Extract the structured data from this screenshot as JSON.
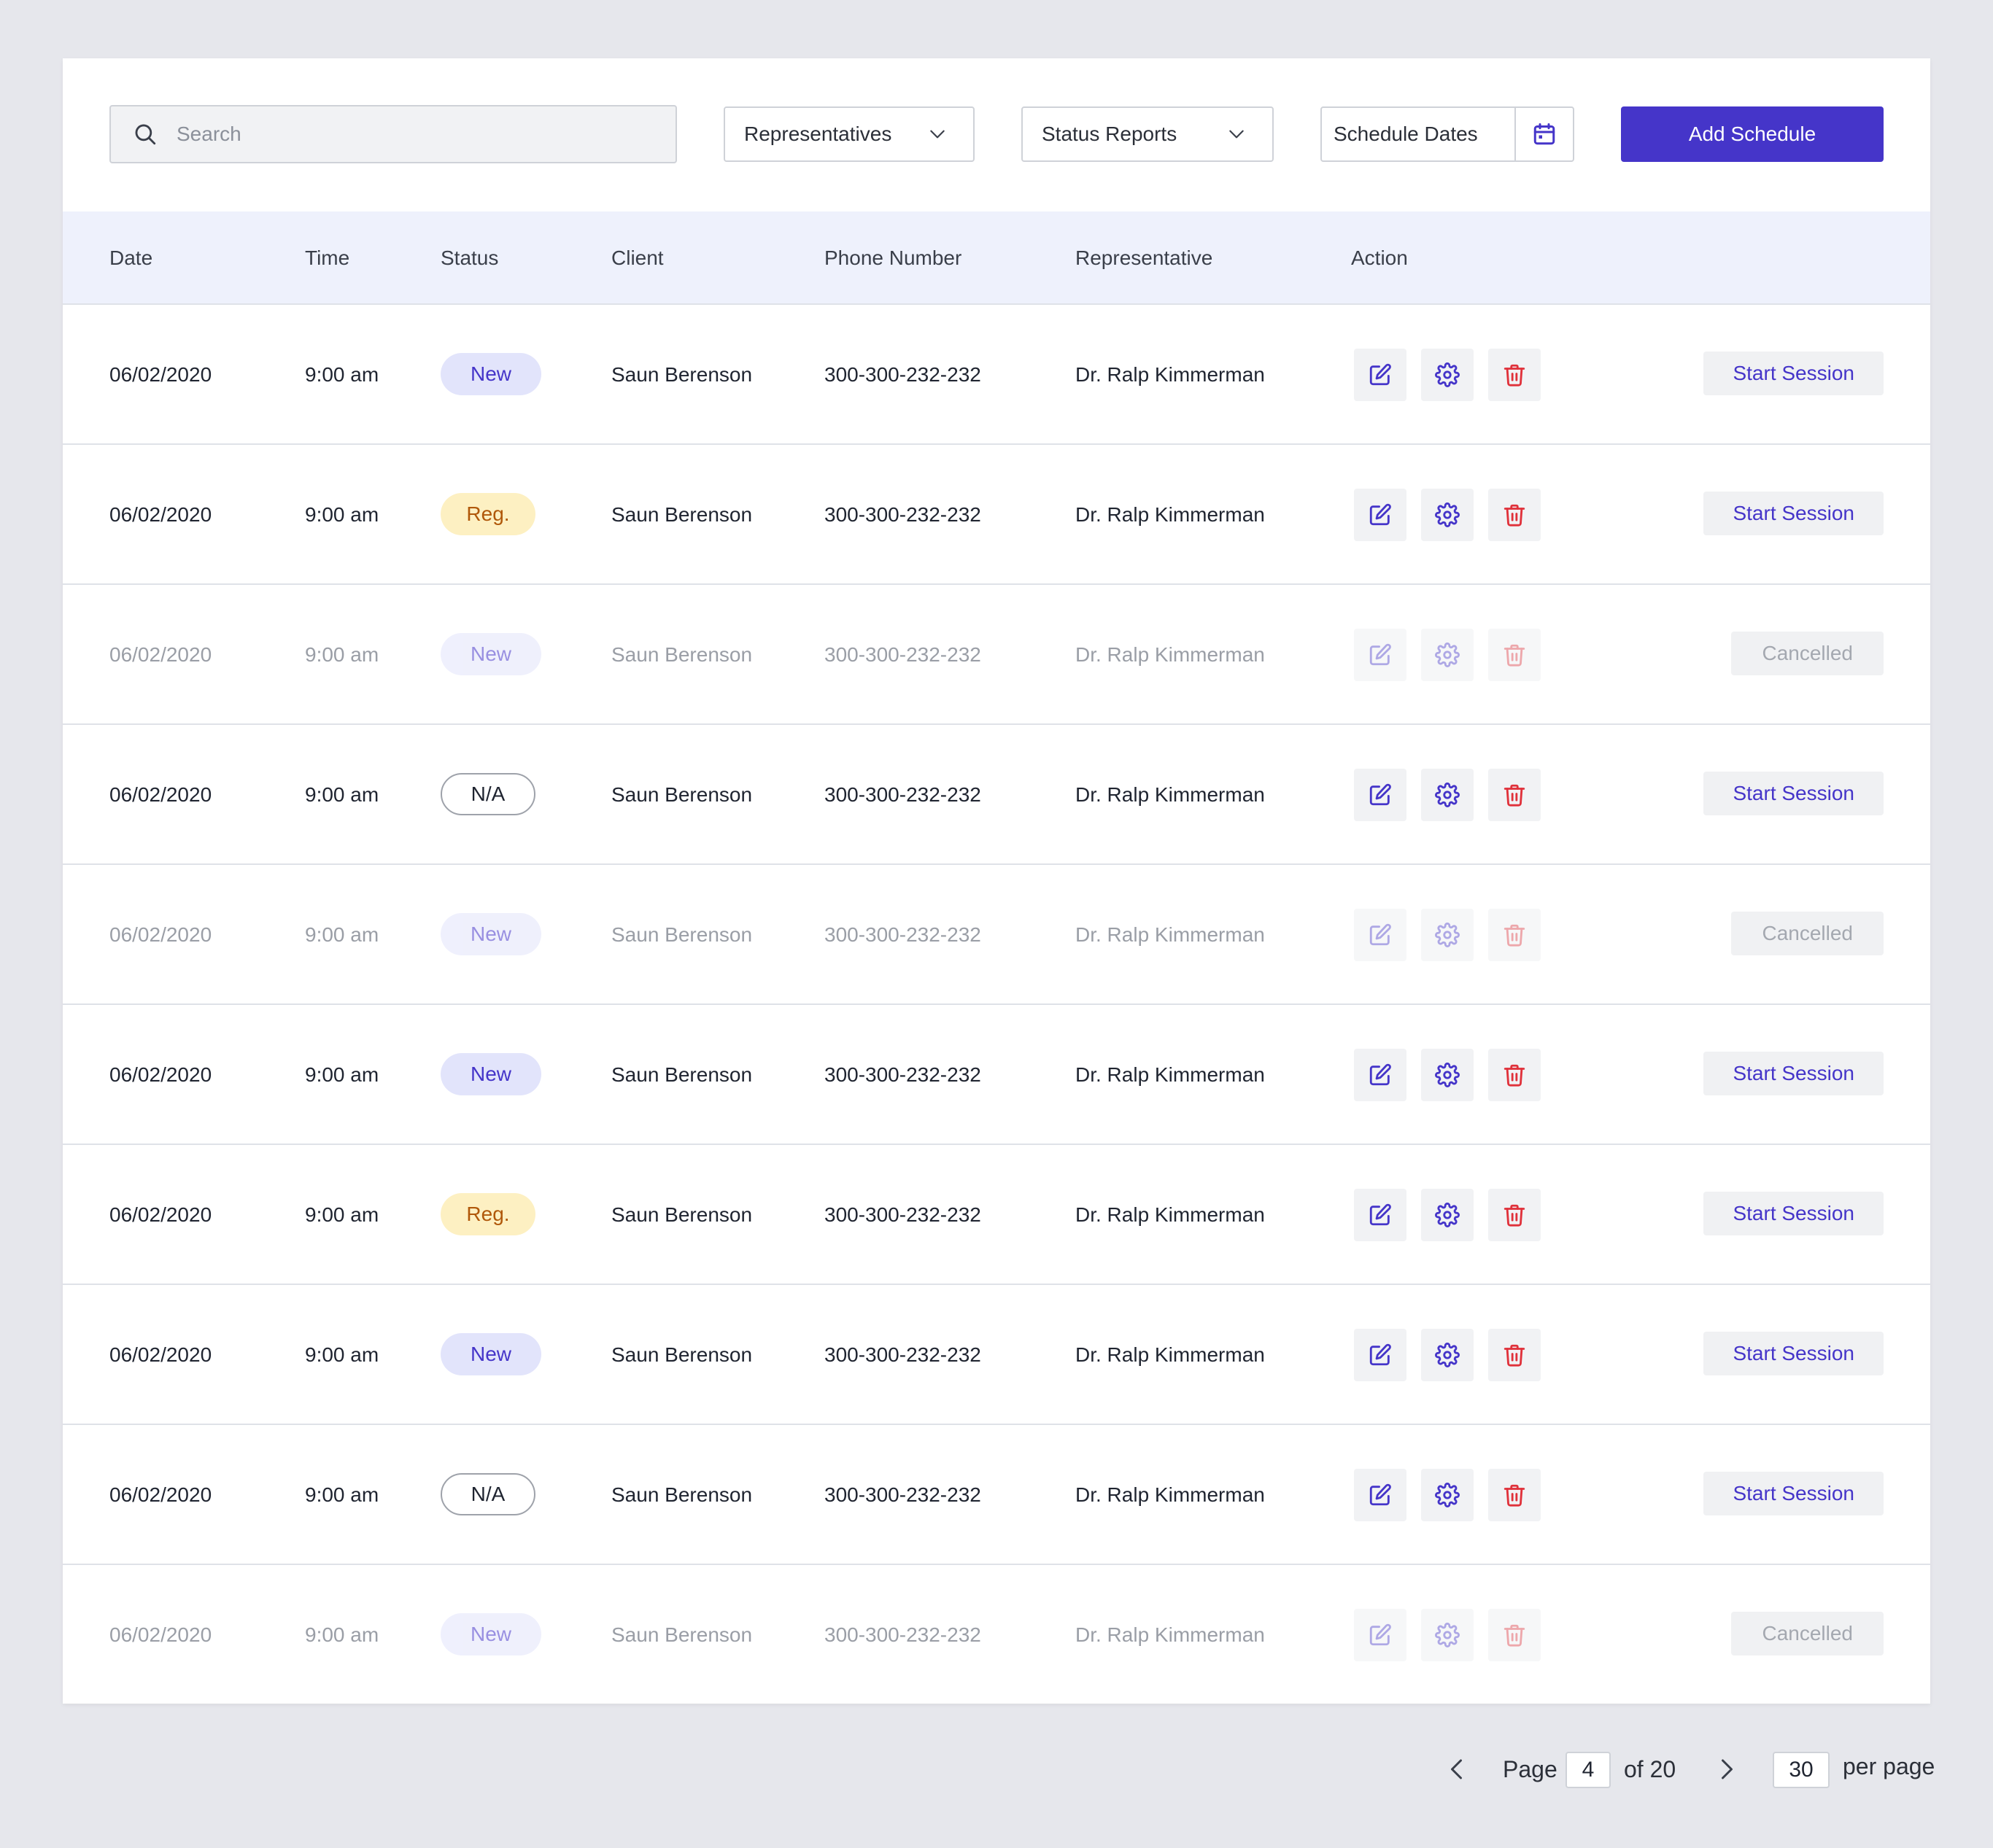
{
  "toolbar": {
    "search_placeholder": "Search",
    "search_value": "",
    "representatives_label": "Representatives",
    "status_reports_label": "Status Reports",
    "schedule_dates_label": "Schedule Dates",
    "add_schedule_label": "Add Schedule",
    "icons": {
      "search": "search-icon",
      "chevron": "chevron-down-icon",
      "calendar": "calendar-icon"
    }
  },
  "table": {
    "headers": {
      "date": "Date",
      "time": "Time",
      "status": "Status",
      "client": "Client",
      "phone": "Phone Number",
      "representative": "Representative",
      "action": "Action"
    },
    "rows": [
      {
        "date": "06/02/2020",
        "time": "9:00 am",
        "status": "New",
        "status_type": "new",
        "client": "Saun Berenson",
        "phone": "300-300-232-232",
        "representative": "Dr. Ralp Kimmerman",
        "session": "Start Session",
        "cancelled": false
      },
      {
        "date": "06/02/2020",
        "time": "9:00 am",
        "status": "Reg.",
        "status_type": "reg",
        "client": "Saun Berenson",
        "phone": "300-300-232-232",
        "representative": "Dr. Ralp Kimmerman",
        "session": "Start Session",
        "cancelled": false
      },
      {
        "date": "06/02/2020",
        "time": "9:00 am",
        "status": "New",
        "status_type": "new",
        "client": "Saun Berenson",
        "phone": "300-300-232-232",
        "representative": "Dr. Ralp Kimmerman",
        "session": "Cancelled",
        "cancelled": true
      },
      {
        "date": "06/02/2020",
        "time": "9:00 am",
        "status": "N/A",
        "status_type": "na",
        "client": "Saun Berenson",
        "phone": "300-300-232-232",
        "representative": "Dr. Ralp Kimmerman",
        "session": "Start Session",
        "cancelled": false
      },
      {
        "date": "06/02/2020",
        "time": "9:00 am",
        "status": "New",
        "status_type": "new",
        "client": "Saun Berenson",
        "phone": "300-300-232-232",
        "representative": "Dr. Ralp Kimmerman",
        "session": "Cancelled",
        "cancelled": true
      },
      {
        "date": "06/02/2020",
        "time": "9:00 am",
        "status": "New",
        "status_type": "new",
        "client": "Saun Berenson",
        "phone": "300-300-232-232",
        "representative": "Dr. Ralp Kimmerman",
        "session": "Start Session",
        "cancelled": false
      },
      {
        "date": "06/02/2020",
        "time": "9:00 am",
        "status": "Reg.",
        "status_type": "reg",
        "client": "Saun Berenson",
        "phone": "300-300-232-232",
        "representative": "Dr. Ralp Kimmerman",
        "session": "Start Session",
        "cancelled": false
      },
      {
        "date": "06/02/2020",
        "time": "9:00 am",
        "status": "New",
        "status_type": "new",
        "client": "Saun Berenson",
        "phone": "300-300-232-232",
        "representative": "Dr. Ralp Kimmerman",
        "session": "Start Session",
        "cancelled": false
      },
      {
        "date": "06/02/2020",
        "time": "9:00 am",
        "status": "N/A",
        "status_type": "na",
        "client": "Saun Berenson",
        "phone": "300-300-232-232",
        "representative": "Dr. Ralp Kimmerman",
        "session": "Start Session",
        "cancelled": false
      },
      {
        "date": "06/02/2020",
        "time": "9:00 am",
        "status": "New",
        "status_type": "new",
        "client": "Saun Berenson",
        "phone": "300-300-232-232",
        "representative": "Dr. Ralp Kimmerman",
        "session": "Cancelled",
        "cancelled": true
      }
    ],
    "action_icons": [
      "edit-icon",
      "gear-icon",
      "trash-icon"
    ]
  },
  "pagination": {
    "page_label": "Page",
    "current_page": "4",
    "of_label": "of 20",
    "per_page_value": "30",
    "per_page_label": "per page",
    "icons": {
      "prev": "chevron-left-icon",
      "next": "chevron-right-icon"
    }
  },
  "colors": {
    "accent": "#4535c9",
    "danger": "#e0313a",
    "header_bg": "#eef1fc",
    "badge_new_bg": "#e2e4fb",
    "badge_reg_bg": "#fdf0c2",
    "badge_reg_text": "#b0580a",
    "page_bg": "#e6e7ec"
  }
}
